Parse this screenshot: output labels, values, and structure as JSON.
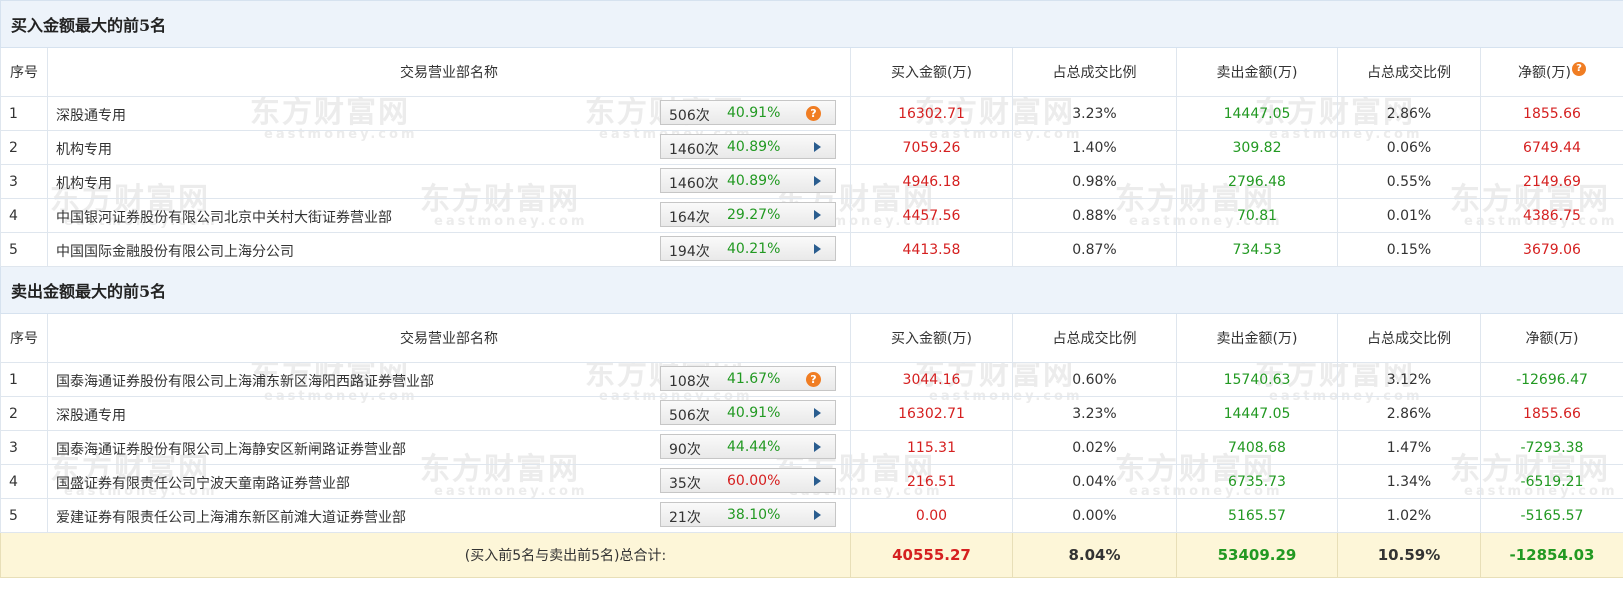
{
  "watermark": {
    "cn": "东方财富网",
    "en": "eastmoney.com"
  },
  "buy_section": {
    "title": "买入金额最大的前5名",
    "headers": {
      "index": "序号",
      "name": "交易营业部名称",
      "buy": "买入金额(万)",
      "buy_ratio": "占总成交比例",
      "sell": "卖出金额(万)",
      "sell_ratio": "占总成交比例",
      "net": "净额(万)"
    },
    "rows": [
      {
        "idx": "1",
        "name": "深股通专用",
        "count": "506次",
        "pct": "40.91%",
        "buy": "16302.71",
        "buy_ratio": "3.23%",
        "sell": "14447.05",
        "sell_ratio": "2.86%",
        "net": "1855.66"
      },
      {
        "idx": "2",
        "name": "机构专用",
        "count": "1460次",
        "pct": "40.89%",
        "buy": "7059.26",
        "buy_ratio": "1.40%",
        "sell": "309.82",
        "sell_ratio": "0.06%",
        "net": "6749.44"
      },
      {
        "idx": "3",
        "name": "机构专用",
        "count": "1460次",
        "pct": "40.89%",
        "buy": "4946.18",
        "buy_ratio": "0.98%",
        "sell": "2796.48",
        "sell_ratio": "0.55%",
        "net": "2149.69"
      },
      {
        "idx": "4",
        "name": "中国银河证券股份有限公司北京中关村大街证券营业部",
        "count": "164次",
        "pct": "29.27%",
        "buy": "4457.56",
        "buy_ratio": "0.88%",
        "sell": "70.81",
        "sell_ratio": "0.01%",
        "net": "4386.75"
      },
      {
        "idx": "5",
        "name": "中国国际金融股份有限公司上海分公司",
        "count": "194次",
        "pct": "40.21%",
        "buy": "4413.58",
        "buy_ratio": "0.87%",
        "sell": "734.53",
        "sell_ratio": "0.15%",
        "net": "3679.06"
      }
    ]
  },
  "sell_section": {
    "title": "卖出金额最大的前5名",
    "headers": {
      "index": "序号",
      "name": "交易营业部名称",
      "buy": "买入金额(万)",
      "buy_ratio": "占总成交比例",
      "sell": "卖出金额(万)",
      "sell_ratio": "占总成交比例",
      "net": "净额(万)"
    },
    "rows": [
      {
        "idx": "1",
        "name": "国泰海通证券股份有限公司上海浦东新区海阳西路证券营业部",
        "count": "108次",
        "pct": "41.67%",
        "buy": "3044.16",
        "buy_ratio": "0.60%",
        "sell": "15740.63",
        "sell_ratio": "3.12%",
        "net": "-12696.47"
      },
      {
        "idx": "2",
        "name": "深股通专用",
        "count": "506次",
        "pct": "40.91%",
        "buy": "16302.71",
        "buy_ratio": "3.23%",
        "sell": "14447.05",
        "sell_ratio": "2.86%",
        "net": "1855.66"
      },
      {
        "idx": "3",
        "name": "国泰海通证券股份有限公司上海静安区新闸路证券营业部",
        "count": "90次",
        "pct": "44.44%",
        "buy": "115.31",
        "buy_ratio": "0.02%",
        "sell": "7408.68",
        "sell_ratio": "1.47%",
        "net": "-7293.38"
      },
      {
        "idx": "4",
        "name": "国盛证券有限责任公司宁波天童南路证券营业部",
        "count": "35次",
        "pct": "60.00%",
        "buy": "216.51",
        "buy_ratio": "0.04%",
        "sell": "6735.73",
        "sell_ratio": "1.34%",
        "net": "-6519.21"
      },
      {
        "idx": "5",
        "name": "爱建证券有限责任公司上海浦东新区前滩大道证券营业部",
        "count": "21次",
        "pct": "38.10%",
        "buy": "0.00",
        "buy_ratio": "0.00%",
        "sell": "5165.57",
        "sell_ratio": "1.02%",
        "net": "-5165.57"
      }
    ]
  },
  "total": {
    "label": "(买入前5名与卖出前5名)总合计:",
    "buy": "40555.27",
    "buy_ratio": "8.04%",
    "sell": "53409.29",
    "sell_ratio": "10.59%",
    "net": "-12854.03"
  },
  "icons": {
    "help": "question-circle-icon",
    "expand": "triangle-right-icon"
  },
  "colors": {
    "positive": "#d52020",
    "negative": "#229922",
    "header_bg": "#edf3fa",
    "total_bg": "#fdf6d8",
    "help_icon": "#f07d23",
    "arrow_icon": "#2a5d8f"
  }
}
